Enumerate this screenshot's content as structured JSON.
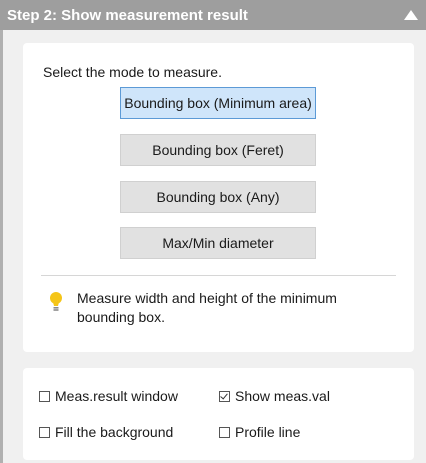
{
  "header": {
    "title": "Step 2: Show measurement result"
  },
  "measure": {
    "prompt": "Select the mode to measure.",
    "modes": [
      {
        "label": "Bounding box (Minimum area)",
        "selected": true
      },
      {
        "label": "Bounding box (Feret)",
        "selected": false
      },
      {
        "label": "Bounding box (Any)",
        "selected": false
      },
      {
        "label": "Max/Min diameter",
        "selected": false
      }
    ],
    "hint": "Measure width and height of the minimum bounding box."
  },
  "options": [
    {
      "label": "Meas.result window",
      "checked": false
    },
    {
      "label": "Show meas.val",
      "checked": true
    },
    {
      "label": "Fill the background",
      "checked": false
    },
    {
      "label": "Profile line",
      "checked": false
    }
  ],
  "colors": {
    "header_bg": "#9e9e9e",
    "selected_bg": "#cfe5fa",
    "selected_border": "#5c9ad6",
    "bulb": "#f5c518"
  }
}
